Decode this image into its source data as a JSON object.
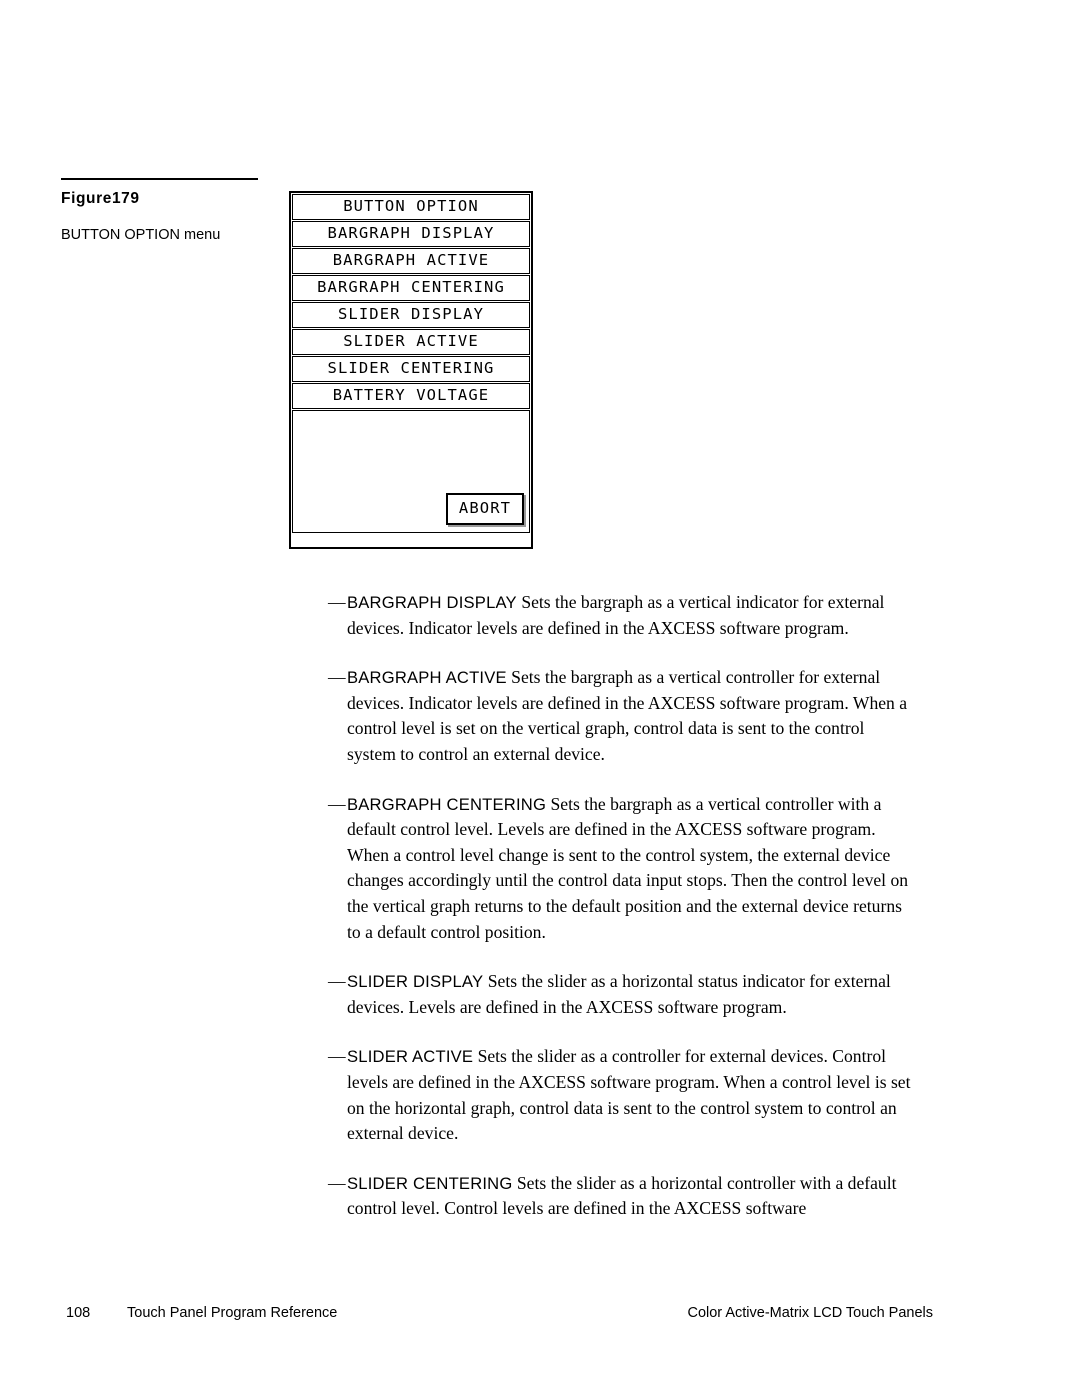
{
  "figure": {
    "number": "Figure179",
    "description": "BUTTON OPTION menu"
  },
  "lcd_panel": {
    "rows": [
      {
        "label": "BUTTON OPTION"
      },
      {
        "label": "BARGRAPH DISPLAY"
      },
      {
        "label": "BARGRAPH ACTIVE"
      },
      {
        "label": "BARGRAPH CENTERING"
      },
      {
        "label": "SLIDER DISPLAY"
      },
      {
        "label": "SLIDER ACTIVE"
      },
      {
        "label": "SLIDER CENTERING"
      },
      {
        "label": "BATTERY VOLTAGE"
      }
    ],
    "abort_label": "ABORT"
  },
  "body": {
    "dash": "—",
    "paragraphs": [
      {
        "term": "BARGRAPH DISPLAY ",
        "text": " Sets the bargraph as a vertical indicator for external devices. Indicator levels are defined in the AXCESS software program."
      },
      {
        "term": "BARGRAPH ACTIVE",
        "text": " Sets the bargraph as a vertical controller for external devices. Indicator levels are defined in the AXCESS software program. When a control level is set on the vertical graph, control data is sent to the control system to control an external device."
      },
      {
        "term": "BARGRAPH CENTERING",
        "text": " Sets the bargraph as a vertical controller with a default control level. Levels are defined in the AXCESS software program. When a control level change is sent to the control system, the external device changes accordingly until the control data input stops. Then the control level on the vertical graph returns to the default position and the external device returns to a default control position."
      },
      {
        "term": "SLIDER DISPLAY ",
        "text": " Sets the slider as a horizontal status indicator for external devices. Levels are defined in the AXCESS software program."
      },
      {
        "term": "SLIDER ACTIVE",
        "text": " Sets the slider as a controller for external devices. Control levels are defined in the AXCESS software program. When a control level is set on the horizontal graph, control data is sent to the control system to control an external device."
      },
      {
        "term": "SLIDER CENTERING",
        "text": " Sets the slider as a horizontal controller with a default control level. Control levels are defined in the AXCESS software"
      }
    ]
  },
  "footer": {
    "page_number": "108",
    "left_text": "Touch Panel Program Reference",
    "right_text": "Color Active-Matrix LCD Touch Panels"
  }
}
